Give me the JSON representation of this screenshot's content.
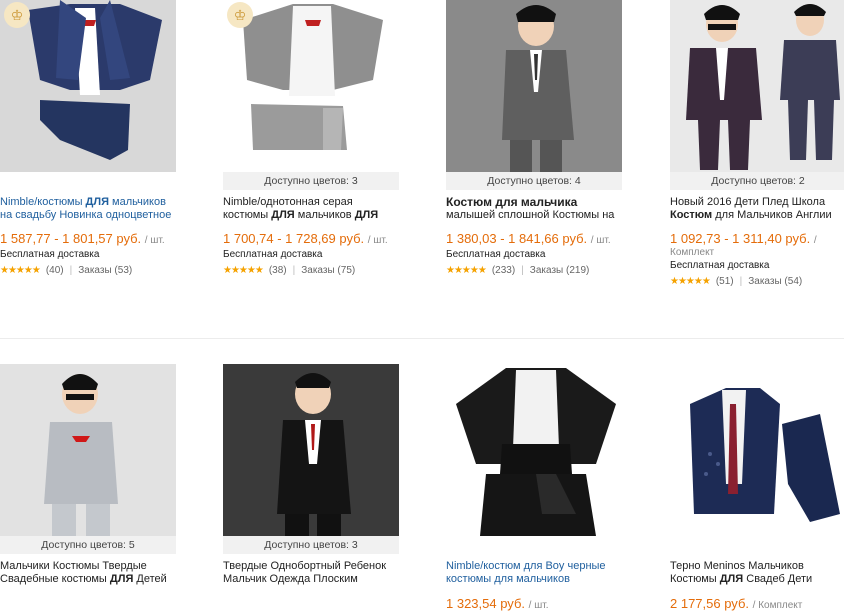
{
  "products": [
    {
      "colors": "",
      "title": [
        "Nimble/костюмы ДЛЯ мальчиков",
        "на свадьбу Новинка одноцветное"
      ],
      "price": "1 587,77 - 1 801,57 руб.",
      "unit": "/ шт.",
      "shipping": "Бесплатная доставка",
      "reviews": "(40)",
      "orders": "Заказы (53)",
      "image": "navy-suit-flat-icon"
    },
    {
      "colors": "Доступно цветов: 3",
      "title": [
        "Nimble/однотонная серая",
        "костюмы ДЛЯ мальчиков ДЛЯ"
      ],
      "price": "1 700,74 - 1 728,69 руб.",
      "unit": "/ шт.",
      "shipping": "Бесплатная доставка",
      "reviews": "(38)",
      "orders": "Заказы (75)",
      "image": "grey-suit-flat-icon"
    },
    {
      "colors": "Доступно цветов: 4",
      "title": [
        "Костюм для мальчика",
        "малышей сплошной Костюмы на"
      ],
      "price": "1 380,03 - 1 841,66 руб.",
      "unit": "/ шт.",
      "shipping": "Бесплатная доставка",
      "reviews": "(233)",
      "orders": "Заказы (219)",
      "image": "boy-grey-suit-icon"
    },
    {
      "colors": "Доступно цветов: 2",
      "title": [
        "Новый 2016 Дети Плед Школа",
        "Костюм для Мальчиков Англии"
      ],
      "price": "1 092,73 - 1 311,40 руб.",
      "unit": "/",
      "unit2": "Комплект",
      "shipping": "Бесплатная доставка",
      "reviews": "(51)",
      "orders": "Заказы (54)",
      "image": "boys-plaid-suit-icon"
    },
    {
      "colors": "Доступно цветов: 5",
      "title": [
        "Мальчики Костюмы Твердые",
        "Свадебные костюмы ДЛЯ Детей"
      ],
      "image": "boy-silver-suit-icon"
    },
    {
      "colors": "Доступно цветов: 3",
      "title": [
        "Твердые Однобортный Ребенок",
        "Мальчик Одежда Плоским"
      ],
      "image": "boy-black-suit-icon"
    },
    {
      "colors": "",
      "title": [
        "Nimble/костюм для Boy черные",
        "костюмы для мальчиков"
      ],
      "price": "1 323,54 руб.",
      "unit": "/ шт.",
      "image": "black-suit-flat-icon"
    },
    {
      "colors": "",
      "title": [
        "Терно Meninos Мальчиков",
        "Костюмы ДЛЯ Свадеб Дети"
      ],
      "price": "2 177,56 руб.",
      "unit": "/ Комплект",
      "image": "navy-blazer-flat-icon"
    }
  ],
  "stars": "★★★★★",
  "logo_glyph": "♔"
}
